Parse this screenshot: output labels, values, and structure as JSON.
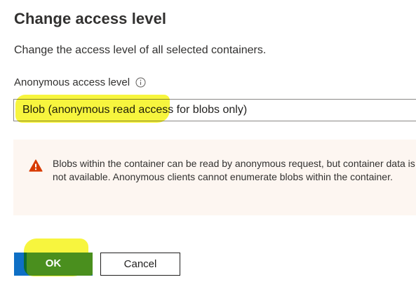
{
  "dialog": {
    "title": "Change access level",
    "subtitle": "Change the access level of all selected containers."
  },
  "access_field": {
    "label": "Anonymous access level",
    "info_icon": "info-icon",
    "selected_value": "Blob (anonymous read access for blobs only)"
  },
  "warning": {
    "icon": "warning-triangle-icon",
    "icon_color": "#d83b01",
    "background": "#fdf6f1",
    "text": "Blobs within the container can be read by anonymous request, but container data is not available. Anonymous clients cannot enumerate blobs within the container."
  },
  "buttons": {
    "ok_label": "OK",
    "cancel_label": "Cancel"
  },
  "colors": {
    "primary": "#0e6fc5",
    "highlight": "#f6f313"
  }
}
